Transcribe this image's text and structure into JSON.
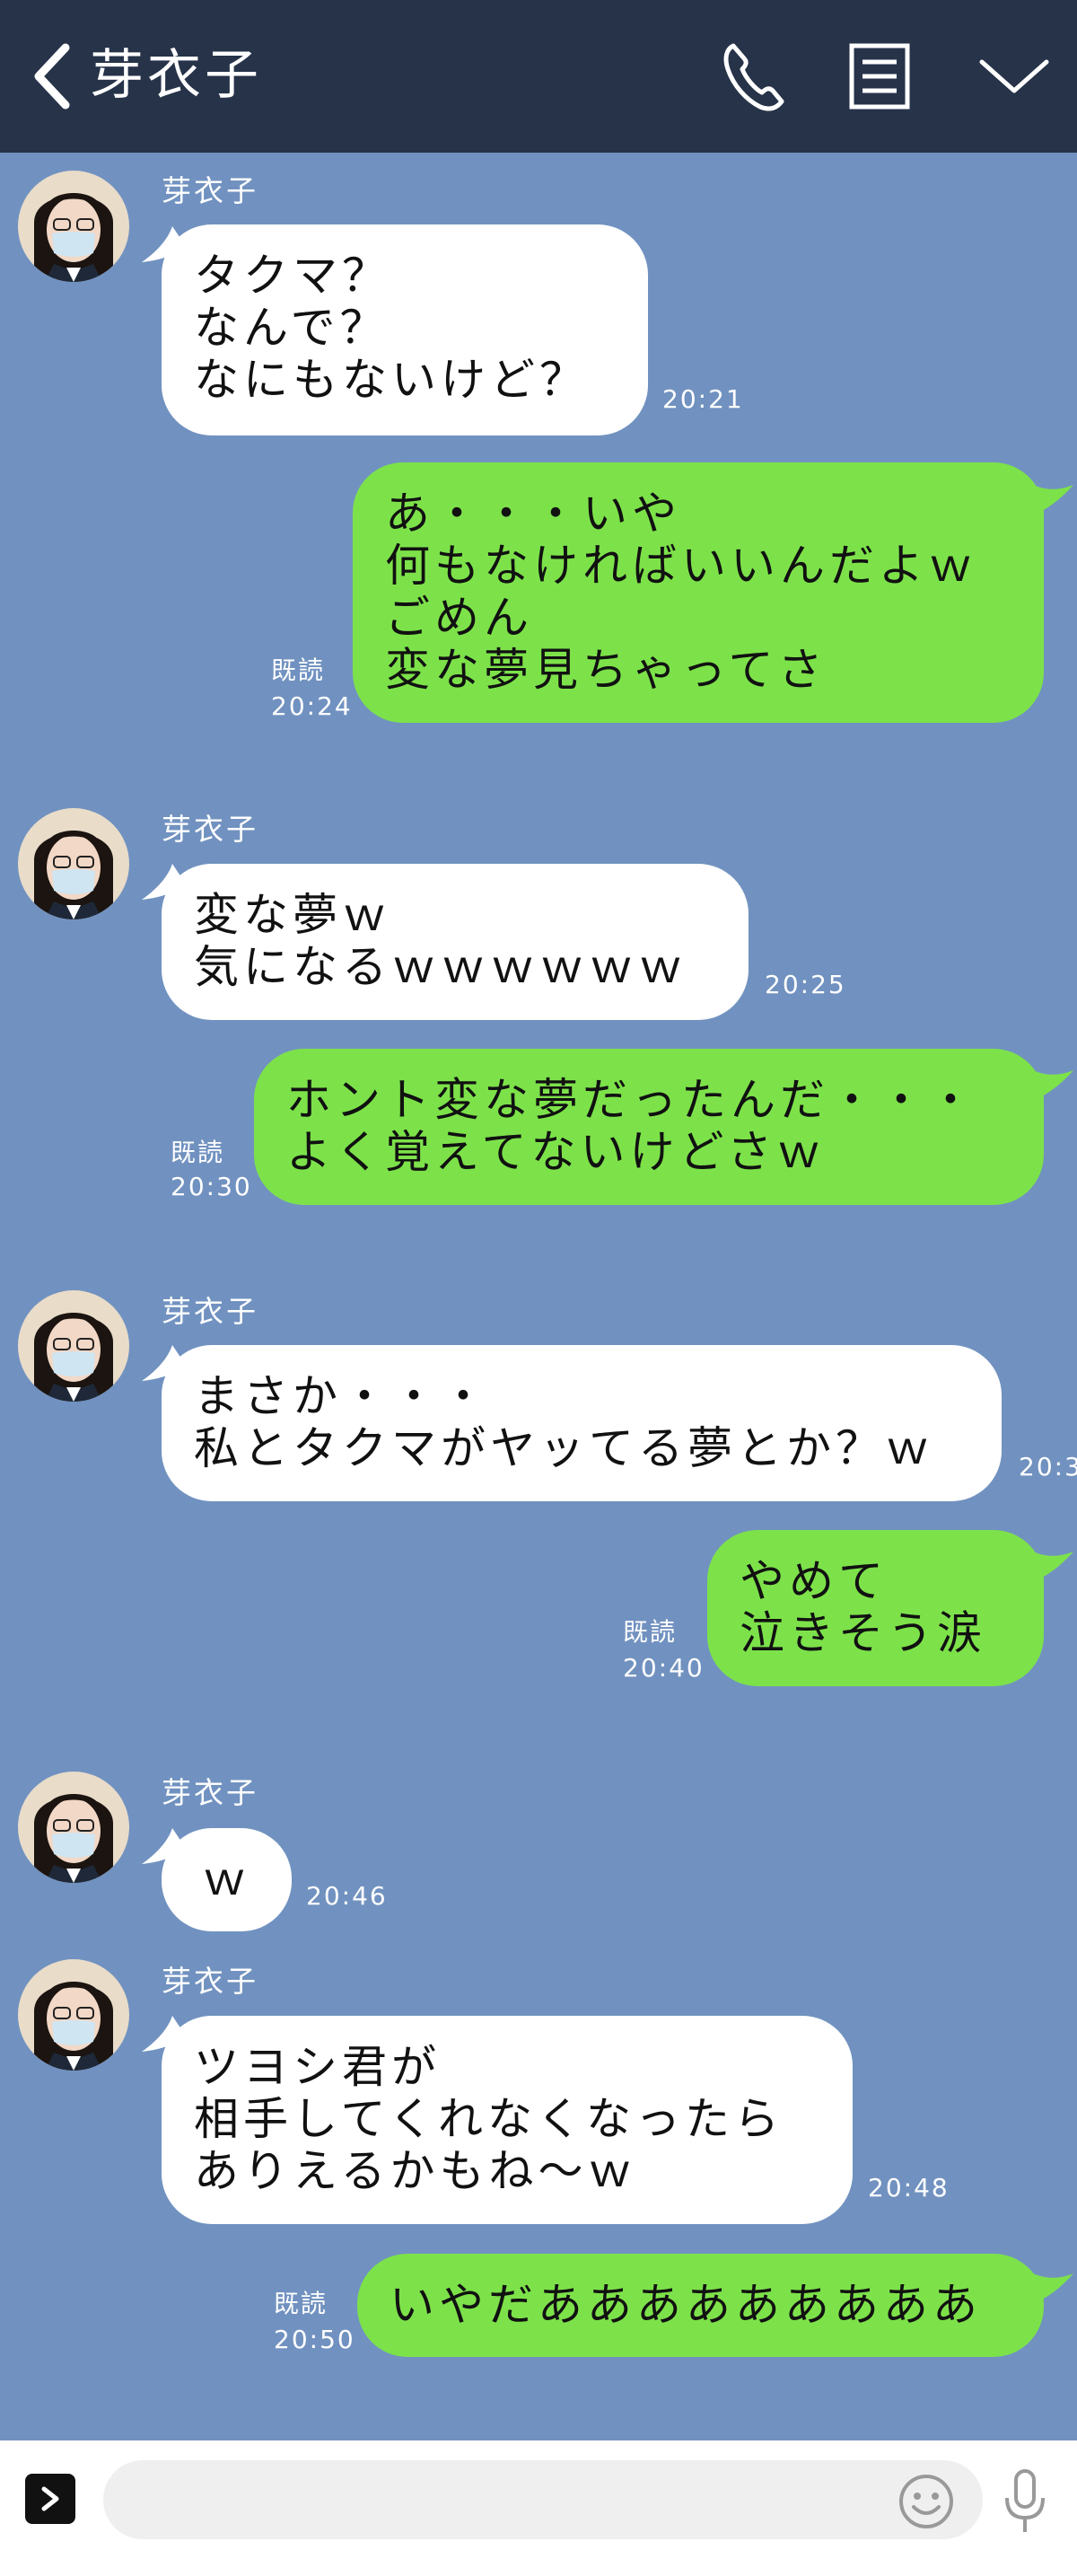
{
  "header": {
    "title": "芽衣子",
    "bg_color": "#263349"
  },
  "colors": {
    "chat_bg": "#7192c0",
    "incoming_bubble": "#ffffff",
    "outgoing_bubble": "#7de24a"
  },
  "icons": {
    "back": "chevron-left-icon",
    "call": "phone-icon",
    "notes": "notes-icon",
    "menu": "chevron-down-icon",
    "expand": "chevron-right-icon",
    "emoji": "smiley-icon",
    "mic": "microphone-icon"
  },
  "messages": [
    {
      "dir": "in",
      "sender": "芽衣子",
      "text": "タクマ？\nなんで？\nなにもないけど？",
      "time": "20:21"
    },
    {
      "dir": "out",
      "read": "既読",
      "text": "あ・・・いや\n何もなければいいんだよｗ\nごめん\n変な夢見ちゃってさ",
      "time": "20:24"
    },
    {
      "dir": "in",
      "sender": "芽衣子",
      "text": "変な夢ｗ\n気になるｗｗｗｗｗｗ",
      "time": "20:25"
    },
    {
      "dir": "out",
      "read": "既読",
      "text": "ホント変な夢だったんだ・・・\nよく覚えてないけどさｗ",
      "time": "20:30"
    },
    {
      "dir": "in",
      "sender": "芽衣子",
      "text": "まさか・・・\n私とタクマがヤッてる夢とか？ｗ",
      "time": "20:3"
    },
    {
      "dir": "out",
      "read": "既読",
      "text": "やめて\n泣きそう涙",
      "time": "20:40"
    },
    {
      "dir": "in",
      "sender": "芽衣子",
      "text": "ｗ",
      "time": "20:46"
    },
    {
      "dir": "in",
      "sender": "芽衣子",
      "text": "ツヨシ君が\n相手してくれなくなったら\nありえるかもね～ｗ",
      "time": "20:48"
    },
    {
      "dir": "out",
      "read": "既読",
      "text": "いやだあああああああああ",
      "time": "20:50"
    }
  ],
  "input": {
    "value": "",
    "placeholder": ""
  }
}
